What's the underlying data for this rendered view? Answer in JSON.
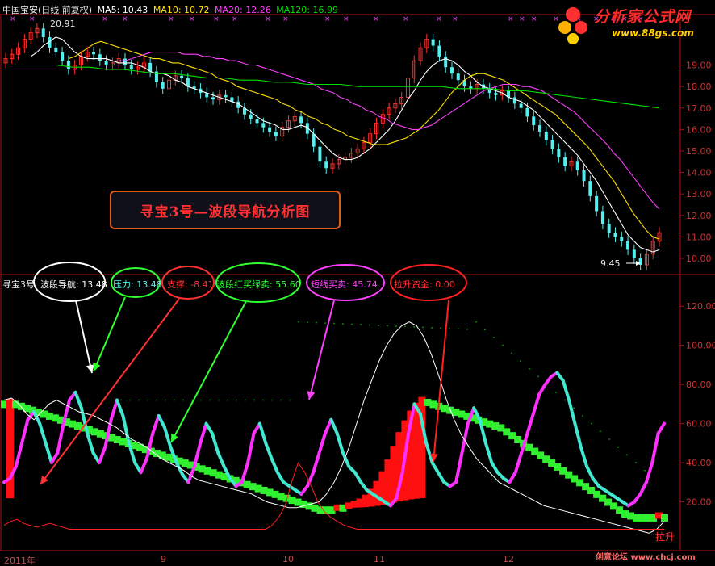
{
  "header": {
    "stock_label": "中国宝安(日线 前复权)",
    "ma5": "MA5: 10.43",
    "ma10": "MA10: 10.72",
    "ma20": "MA20: 12.26",
    "ma120": "MA120: 16.99"
  },
  "indicator": {
    "name": "寻宝3号",
    "labels": [
      "波段导航: 13.48",
      "压力: 13.48",
      "支撑: -8.41",
      "波段红买绿卖: 55.60",
      "短线买卖: 45.74",
      "拉升资金: 0.00"
    ]
  },
  "title_box": "寻宝3号—波段导航分析图",
  "logo": {
    "main": "分析家公式网",
    "url": "www.88gs.com"
  },
  "watermark": "创意论坛 www.chcj.com",
  "annotations": {
    "high": "20.91",
    "low": "9.45",
    "lasheng": "拉升"
  },
  "time_axis": {
    "labels": [
      "2011年",
      "9",
      "10",
      "11",
      "12"
    ]
  },
  "colors": {
    "up": "#ff3030",
    "down": "#54f0f0",
    "ma5": "#ffffff",
    "ma10": "#ffe000",
    "ma20": "#ff40ff",
    "ma120": "#00e000",
    "axis": "#b01010"
  },
  "chart_data": [
    {
      "type": "candlestick",
      "ylim": [
        9.4,
        21.2
      ],
      "y_ticks": [
        10.0,
        11.0,
        12.0,
        13.0,
        14.0,
        15.0,
        16.0,
        17.0,
        18.0,
        19.0
      ],
      "close": [
        19.3,
        19.5,
        19.8,
        20.2,
        20.5,
        20.7,
        20.3,
        19.8,
        19.6,
        19.2,
        18.8,
        19.0,
        19.4,
        19.6,
        19.5,
        19.2,
        19.0,
        19.1,
        19.3,
        19.0,
        18.8,
        18.9,
        19.1,
        18.7,
        18.2,
        17.9,
        18.3,
        18.5,
        18.4,
        18.0,
        17.9,
        17.7,
        17.5,
        17.4,
        17.6,
        17.5,
        17.3,
        17.0,
        16.7,
        16.5,
        16.3,
        16.1,
        15.9,
        15.7,
        16.1,
        16.4,
        16.6,
        16.3,
        15.8,
        15.2,
        14.5,
        14.2,
        14.4,
        14.6,
        14.7,
        14.9,
        15.1,
        15.4,
        15.8,
        16.3,
        16.7,
        17.0,
        17.2,
        17.5,
        18.4,
        19.2,
        19.8,
        20.2,
        19.9,
        19.4,
        18.9,
        18.6,
        18.3,
        18.0,
        17.9,
        18.1,
        17.9,
        17.7,
        17.6,
        17.8,
        17.5,
        17.2,
        17.0,
        16.6,
        16.2,
        15.9,
        15.5,
        15.1,
        14.7,
        14.3,
        14.5,
        14.1,
        13.6,
        12.9,
        12.2,
        11.6,
        11.2,
        11.0,
        10.8,
        10.4,
        10.0,
        9.7,
        10.2,
        10.8,
        11.2
      ],
      "ma_series": [
        {
          "values": [
            19.4,
            19.6,
            19.9,
            20.1,
            20.3,
            20.2,
            19.9,
            19.6,
            19.4,
            19.3,
            19.3,
            19.3,
            19.3,
            19.2,
            19.1,
            19.1,
            19.1,
            19.0,
            18.9,
            18.7,
            18.6,
            18.6,
            18.5,
            18.3,
            18.2,
            18.0,
            17.9,
            17.8,
            17.7,
            17.6,
            17.5,
            17.4,
            17.3,
            17.2,
            17.0,
            16.8,
            16.6,
            16.4,
            16.3,
            16.2,
            16.0,
            16.0,
            16.1,
            16.2,
            16.1,
            15.8,
            15.5,
            15.2,
            14.9,
            14.7,
            14.6,
            14.6,
            14.7,
            14.9,
            15.1,
            15.4,
            15.7,
            16.0,
            16.4,
            16.9,
            17.4,
            17.8,
            18.3,
            18.7,
            19.0,
            19.2,
            19.3,
            19.2,
            19.0,
            18.7,
            18.5,
            18.2,
            18.0,
            17.9,
            17.8,
            17.7,
            17.5,
            17.4,
            17.3,
            17.1,
            16.9,
            16.6,
            16.3,
            16.0,
            15.7,
            15.4,
            15.1,
            14.8,
            14.4,
            14.0,
            13.6,
            13.1,
            12.6,
            12.1,
            11.6,
            11.1,
            10.8,
            10.5,
            10.4,
            10.3,
            10.4
          ]
        },
        {
          "values": [
            19.3,
            19.4,
            19.6,
            19.8,
            20.0,
            20.1,
            20.0,
            19.9,
            19.8,
            19.7,
            19.6,
            19.5,
            19.4,
            19.3,
            19.3,
            19.2,
            19.1,
            19.1,
            19.0,
            18.9,
            18.8,
            18.7,
            18.6,
            18.4,
            18.3,
            18.2,
            18.0,
            17.9,
            17.8,
            17.7,
            17.6,
            17.5,
            17.4,
            17.2,
            17.1,
            16.9,
            16.8,
            16.6,
            16.5,
            16.3,
            16.2,
            16.0,
            15.9,
            15.7,
            15.6,
            15.5,
            15.4,
            15.3,
            15.3,
            15.3,
            15.4,
            15.5,
            15.6,
            15.8,
            16.0,
            16.3,
            16.6,
            16.9,
            17.3,
            17.7,
            18.0,
            18.3,
            18.5,
            18.6,
            18.6,
            18.5,
            18.4,
            18.3,
            18.1,
            17.9,
            17.7,
            17.5,
            17.3,
            17.1,
            16.9,
            16.7,
            16.4,
            16.1,
            15.8,
            15.5,
            15.2,
            14.8,
            14.4,
            14.0,
            13.6,
            13.1,
            12.6,
            12.1,
            11.7,
            11.3,
            11.0,
            10.9
          ]
        },
        {
          "values": [
            19.2,
            19.2,
            19.3,
            19.4,
            19.5,
            19.6,
            19.6,
            19.6,
            19.6,
            19.6,
            19.5,
            19.5,
            19.5,
            19.4,
            19.4,
            19.3,
            19.3,
            19.2,
            19.2,
            19.1,
            19.0,
            19.0,
            18.9,
            18.8,
            18.7,
            18.6,
            18.5,
            18.4,
            18.3,
            18.2,
            18.1,
            17.9,
            17.8,
            17.7,
            17.5,
            17.4,
            17.2,
            17.1,
            16.9,
            16.8,
            16.6,
            16.5,
            16.3,
            16.2,
            16.1,
            16.0,
            16.0,
            16.1,
            16.2,
            16.4,
            16.6,
            16.8,
            17.0,
            17.2,
            17.4,
            17.6,
            17.8,
            17.9,
            18.0,
            18.1,
            18.1,
            18.1,
            18.0,
            18.0,
            17.9,
            17.8,
            17.6,
            17.4,
            17.2,
            17.0,
            16.8,
            16.5,
            16.2,
            15.9,
            15.6,
            15.3,
            14.9,
            14.6,
            14.2,
            13.8,
            13.4,
            13.0,
            12.6,
            12.3
          ]
        },
        {
          "values": [
            19.0,
            19.0,
            19.0,
            19.0,
            18.9,
            18.9,
            18.8,
            18.8,
            18.7,
            18.6,
            18.6,
            18.5,
            18.4,
            18.4,
            18.3,
            18.3,
            18.2,
            18.2,
            18.1,
            18.1,
            18.1,
            18.0,
            18.0,
            18.0,
            18.0,
            18.0,
            18.0,
            17.9,
            17.9,
            17.9,
            17.8,
            17.8,
            17.7,
            17.6,
            17.5,
            17.4,
            17.3,
            17.2,
            17.1,
            17.0
          ]
        }
      ]
    },
    {
      "type": "line",
      "ylim": [
        0,
        130
      ],
      "y_ticks": [
        20.0,
        40.0,
        60.0,
        80.0,
        100.0,
        120.0
      ],
      "series": [
        {
          "values": [
            70,
            71,
            70,
            69,
            68,
            67,
            66,
            65,
            64,
            63,
            62,
            61,
            60,
            59,
            58,
            57,
            56,
            55,
            54,
            53,
            52,
            51,
            50,
            49,
            48,
            47,
            46,
            45,
            44,
            43,
            42,
            41,
            40,
            39,
            38,
            37,
            36,
            35,
            34,
            33,
            32,
            31,
            30,
            29,
            28,
            27,
            26,
            25,
            24,
            23,
            22,
            21,
            20,
            19,
            18,
            17,
            16,
            16,
            16,
            17,
            17,
            18,
            19,
            20,
            22,
            25,
            29,
            34,
            40,
            47,
            54,
            60,
            65,
            69,
            72,
            71,
            70,
            69,
            68,
            67,
            66,
            65,
            64,
            63,
            62,
            61,
            60,
            59,
            58,
            56,
            54,
            52,
            50,
            48,
            46,
            44,
            42,
            40,
            38,
            36,
            34,
            32,
            30,
            28,
            26,
            24,
            22,
            20,
            18,
            16,
            14,
            13,
            12,
            12,
            12,
            12,
            13,
            12
          ]
        },
        {
          "values": [
            30,
            32,
            38,
            50,
            62,
            66,
            60,
            50,
            40,
            45,
            60,
            72,
            76,
            68,
            55,
            45,
            40,
            48,
            62,
            72,
            64,
            50,
            40,
            35,
            42,
            55,
            64,
            58,
            48,
            40,
            34,
            30,
            38,
            50,
            60,
            55,
            45,
            38,
            32,
            28,
            30,
            40,
            55,
            60,
            50,
            42,
            35,
            30,
            28,
            26,
            24,
            28,
            35,
            45,
            55,
            62,
            55,
            45,
            38,
            35,
            30,
            26,
            24,
            22,
            20,
            18,
            22,
            35,
            55,
            70,
            65,
            50,
            40,
            35,
            30,
            28,
            30,
            45,
            60,
            68,
            62,
            50,
            40,
            35,
            32,
            30,
            35,
            45,
            55,
            65,
            75,
            80,
            84,
            86,
            82,
            72,
            60,
            48,
            38,
            32,
            28,
            26,
            24,
            22,
            20,
            18,
            20,
            24,
            30,
            40,
            55,
            60
          ]
        },
        {
          "values": [
            72,
            73,
            70,
            65,
            62,
            66,
            70,
            72,
            70,
            68,
            66,
            65,
            64,
            62,
            60,
            58,
            55,
            52,
            50,
            48,
            45,
            42,
            40,
            38,
            36,
            33,
            31,
            30,
            29,
            28,
            27,
            26,
            25,
            24,
            22,
            20,
            19,
            18,
            17,
            17,
            18,
            19,
            20,
            24,
            30,
            38,
            48,
            60,
            72,
            82,
            92,
            100,
            106,
            110,
            112,
            110,
            104,
            95,
            84,
            72,
            62,
            54,
            48,
            42,
            38,
            34,
            30,
            28,
            26,
            24,
            22,
            20,
            18,
            17,
            16,
            15,
            14,
            13,
            12,
            11,
            10,
            9,
            8,
            7,
            6,
            5,
            4,
            6,
            10
          ]
        },
        {
          "values": [
            8,
            10,
            11,
            9,
            8,
            7,
            8,
            9,
            8,
            7,
            6,
            6,
            6,
            6,
            6,
            6,
            6,
            6,
            6,
            6,
            6,
            6,
            6,
            6,
            6,
            6,
            6,
            6,
            6,
            6,
            6,
            6,
            6,
            6,
            6,
            6,
            6,
            6,
            6,
            6,
            6,
            8,
            12,
            18,
            30,
            40,
            35,
            28,
            20,
            15,
            12,
            10,
            8,
            7,
            6,
            6,
            6,
            6,
            6,
            6,
            6,
            6,
            6,
            6,
            6,
            6,
            6,
            6,
            6,
            6,
            6,
            6,
            6,
            6,
            6,
            6,
            6,
            6,
            6,
            6,
            6,
            6,
            6,
            6,
            6,
            6,
            6,
            6,
            6,
            6,
            6,
            6,
            6,
            6,
            6,
            6,
            6,
            6,
            6,
            6,
            6,
            6
          ]
        }
      ]
    }
  ]
}
